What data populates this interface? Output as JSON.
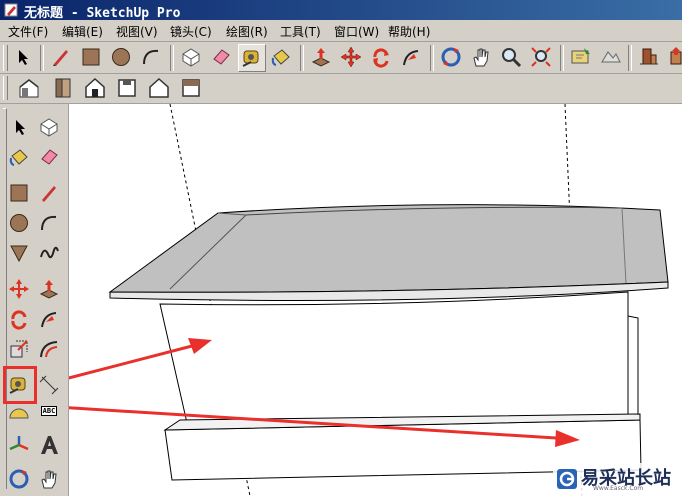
{
  "window": {
    "title": "无标题 - SketchUp Pro",
    "app_icon": "sketchup-pencil-icon"
  },
  "menubar": {
    "items": [
      "文件(F)",
      "编辑(E)",
      "视图(V)",
      "镜头(C)",
      "绘图(R)",
      "工具(T)",
      "窗口(W)",
      "帮助(H)"
    ]
  },
  "toolbar_main": {
    "icons": [
      "select-arrow-icon",
      "pencil-line-icon",
      "rectangle-icon",
      "circle-icon",
      "arc-icon",
      "make-component-icon",
      "eraser-icon",
      "tape-measure-icon",
      "paint-bucket-icon",
      "push-pull-icon",
      "move-icon",
      "rotate-icon",
      "follow-me-icon",
      "orbit-icon",
      "pan-hand-icon",
      "zoom-icon",
      "zoom-extents-icon",
      "add-location-icon",
      "toggle-terrain-icon",
      "get-models-icon",
      "share-model-icon"
    ]
  },
  "toolbar_views": {
    "icons": [
      "iso-view-icon",
      "top-view-icon",
      "front-view-icon",
      "right-view-icon",
      "back-view-icon",
      "left-view-icon"
    ]
  },
  "left_toolbar": {
    "icons": [
      "select-arrow-icon",
      "make-component-icon",
      "paint-bucket-icon",
      "eraser-icon",
      "rectangle-icon",
      "pencil-line-icon",
      "circle-icon",
      "arc-icon",
      "polygon-icon",
      "freehand-icon",
      "move-icon",
      "push-pull-icon",
      "rotate-icon",
      "follow-me-icon",
      "scale-icon",
      "offset-icon",
      "tape-measure-icon",
      "dimension-icon",
      "protractor-icon",
      "text-label-icon",
      "axes-icon",
      "3d-text-icon",
      "orbit-icon",
      "pan-hand-icon"
    ],
    "text_tool_label": "ABC"
  },
  "watermark": {
    "text": "易采站长站",
    "url": "Www.Easck.Com"
  },
  "colors": {
    "highlight": "#e9302c",
    "arrow": "#e9302c",
    "roof_fill": "#c0c0c0",
    "face_fill": "#ffffff",
    "edge": "#000000"
  }
}
